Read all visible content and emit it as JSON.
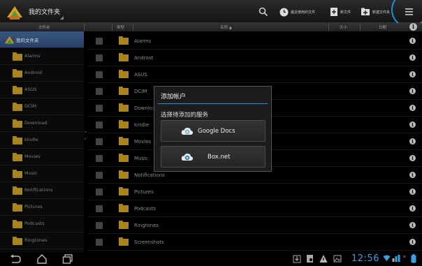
{
  "topbar": {
    "title": "我的文件夹",
    "actions": [
      {
        "icon": "search-icon",
        "label": ""
      },
      {
        "icon": "clock-icon",
        "label": "最近使用的文件"
      },
      {
        "icon": "new-file-icon",
        "label": "新文件"
      },
      {
        "icon": "new-folder-icon",
        "label": "新建文件夹"
      }
    ],
    "menu_icon": "overflow-menu-icon"
  },
  "columns": {
    "tree_header": "文件夹",
    "type": "类型",
    "name": "名称 ▲",
    "size": "大小",
    "date": "日期"
  },
  "tree": {
    "root": "我的文件夹",
    "items": [
      "Alarms",
      "Android",
      "ASUS",
      "DCIM",
      "Download",
      "kindle",
      "Movies",
      "Music",
      "Notifications",
      "Pictures",
      "Podcasts",
      "Ringtones"
    ]
  },
  "files": [
    "Alarms",
    "Android",
    "ASUS",
    "DCIM",
    "Download",
    "kindle",
    "Movies",
    "Music",
    "Notifications",
    "Pictures",
    "Podcasts",
    "Ringtones",
    "Screenshots"
  ],
  "dialog": {
    "title": "添加帐户",
    "subtitle": "选择待添加的服务",
    "services": [
      "Google Docs",
      "Box.net"
    ]
  },
  "status": {
    "time": "12:56"
  },
  "colors": {
    "accent": "#1e90d6",
    "folder": "#b8921f",
    "clock": "#3aa0e0"
  }
}
